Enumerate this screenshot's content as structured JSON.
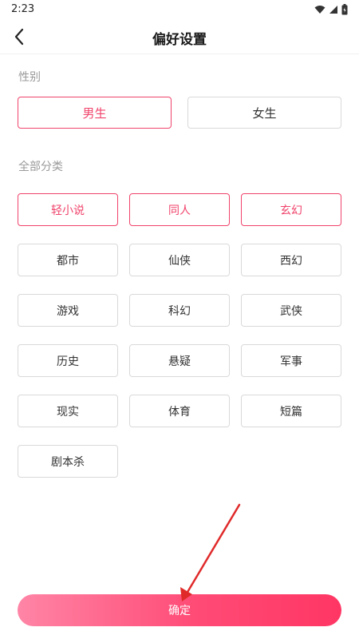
{
  "status_bar": {
    "time": "2:23"
  },
  "header": {
    "title": "偏好设置"
  },
  "gender": {
    "label": "性别",
    "options": [
      {
        "label": "男生",
        "selected": true
      },
      {
        "label": "女生",
        "selected": false
      }
    ]
  },
  "categories": {
    "label": "全部分类",
    "items": [
      {
        "label": "轻小说",
        "selected": true
      },
      {
        "label": "同人",
        "selected": true
      },
      {
        "label": "玄幻",
        "selected": true
      },
      {
        "label": "都市",
        "selected": false
      },
      {
        "label": "仙侠",
        "selected": false
      },
      {
        "label": "西幻",
        "selected": false
      },
      {
        "label": "游戏",
        "selected": false
      },
      {
        "label": "科幻",
        "selected": false
      },
      {
        "label": "武侠",
        "selected": false
      },
      {
        "label": "历史",
        "selected": false
      },
      {
        "label": "悬疑",
        "selected": false
      },
      {
        "label": "军事",
        "selected": false
      },
      {
        "label": "现实",
        "selected": false
      },
      {
        "label": "体育",
        "selected": false
      },
      {
        "label": "短篇",
        "selected": false
      },
      {
        "label": "剧本杀",
        "selected": false
      }
    ]
  },
  "confirm": {
    "label": "确定"
  },
  "colors": {
    "accent": "#f0436b",
    "button_gradient_start": "#ff85a6",
    "button_gradient_end": "#ff3664",
    "annotation_arrow": "#e02a2a"
  },
  "icons": {
    "back": "chevron-left-icon",
    "wifi": "wifi-icon",
    "signal": "signal-icon",
    "battery": "battery-icon"
  }
}
